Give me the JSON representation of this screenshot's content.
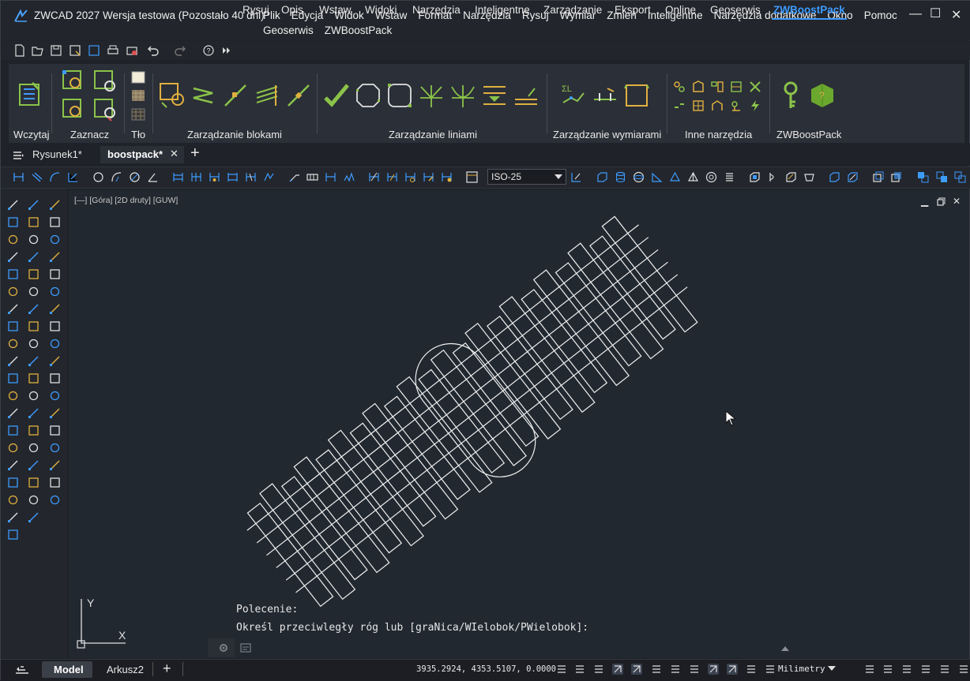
{
  "window": {
    "title": "ZWCAD 2027 Wersja testowa (Pozostało 40 dni)",
    "menu": [
      "Plik",
      "Edycja",
      "Widok",
      "Wstaw",
      "Format",
      "Narzędzia",
      "Rysuj",
      "Wymiar",
      "Zmień",
      "Inteligentne",
      "Narzędzia dodatkowe",
      "Okno",
      "Pomoc"
    ],
    "menu_row2": [
      "Geoserwis",
      "ZWBoostPack"
    ],
    "controls": {
      "minimize": "—",
      "maximize": "☐",
      "close": "✕"
    }
  },
  "ribbon": {
    "tabs": [
      "Rysuj",
      "Opis",
      "Wstaw",
      "Widoki",
      "Narzędzia",
      "Inteligentne",
      "Zarządzanie",
      "Eksport",
      "Online",
      "Geoserwis",
      "ZWBoostPack"
    ],
    "active_tab": "ZWBoostPack",
    "groups": [
      "Wczytaj",
      "Zaznacz",
      "Tło",
      "Zarządzanie blokami",
      "Zarządzanie liniami",
      "Zarządzanie wymiarami",
      "Inne narzędzia",
      "ZWBoostPack"
    ],
    "accent_color": "#3d9bff",
    "icon_color": "#8bc34a"
  },
  "documents": {
    "menu_icon": "list-menu-icon",
    "tabs": [
      {
        "label": "Rysunek1*",
        "active": false
      },
      {
        "label": "boostpack*",
        "active": true
      }
    ],
    "close": "✕",
    "add": "+"
  },
  "toolbar": {
    "dimstyle": "ISO-25"
  },
  "viewport": {
    "label": "[—] [Góra] [2D druty] [GUW]",
    "ucs": {
      "y": "Y",
      "x": "X"
    }
  },
  "command": {
    "line1": "Polecenie:",
    "line2": "Określ przeciwległy róg lub [graNica/WIelobok/PWielobok]:"
  },
  "status": {
    "layout_tabs": [
      "Model",
      "Arkusz2"
    ],
    "active_layout": "Model",
    "add": "+",
    "coordinates": "3935.2924, 4353.5107, 0.0000",
    "units": "Milimetry"
  }
}
